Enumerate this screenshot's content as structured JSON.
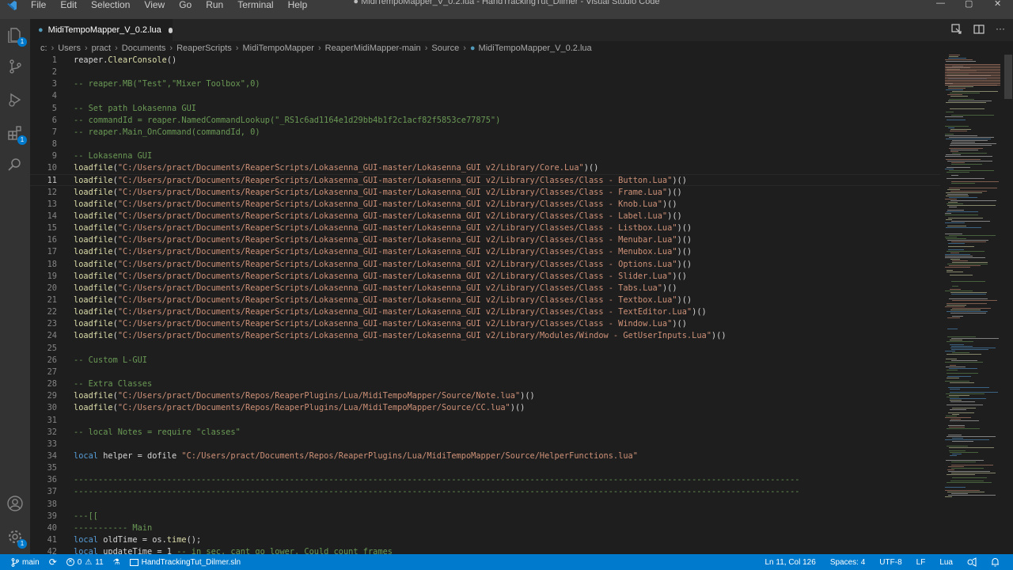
{
  "window": {
    "title": "● MidiTempoMapper_V_0.2.lua - HandTrackingTut_Dilmer - Visual Studio Code",
    "menu": [
      "File",
      "Edit",
      "Selection",
      "View",
      "Go",
      "Run",
      "Terminal",
      "Help"
    ]
  },
  "colors": {
    "accent": "#007acc",
    "comment": "#6a9955",
    "string": "#ce9178",
    "keyword": "#569cd6",
    "function": "#dcdcaa"
  },
  "activity_bar": {
    "items": [
      {
        "icon": "files-icon",
        "badge": "1"
      },
      {
        "icon": "source-control-icon"
      },
      {
        "icon": "run-debug-icon"
      },
      {
        "icon": "extensions-icon",
        "badge": "1"
      },
      {
        "icon": "search-icon"
      }
    ],
    "bottom": [
      {
        "icon": "account-icon"
      },
      {
        "icon": "settings-gear-icon",
        "badge": "1"
      }
    ]
  },
  "tab": {
    "label": "MidiTempoMapper_V_0.2.lua",
    "modified": true
  },
  "breadcrumb": [
    "c:",
    "Users",
    "pract",
    "Documents",
    "ReaperScripts",
    "MidiTempoMapper",
    "ReaperMidiMapper-main",
    "Source",
    "MidiTempoMapper_V_0.2.lua"
  ],
  "editor": {
    "active_line": 11,
    "lines": [
      {
        "n": "1",
        "text": "reaper.ClearConsole()"
      },
      {
        "n": "2",
        "text": ""
      },
      {
        "n": "3",
        "text": "-- reaper.MB(\"Test\",\"Mixer Toolbox\",0)"
      },
      {
        "n": "4",
        "text": ""
      },
      {
        "n": "5",
        "text": "-- Set path Lokasenna GUI"
      },
      {
        "n": "6",
        "text": "-- commandId = reaper.NamedCommandLookup(\"_RS1c6ad1164e1d29bb4b1f2c1acf82f5853ce77875\")"
      },
      {
        "n": "7",
        "text": "-- reaper.Main_OnCommand(commandId, 0)"
      },
      {
        "n": "8",
        "text": ""
      },
      {
        "n": "9",
        "text": "-- Lokasenna GUI"
      },
      {
        "n": "10",
        "text": "loadfile(\"C:/Users/pract/Documents/ReaperScripts/Lokasenna_GUI-master/Lokasenna_GUI v2/Library/Core.Lua\")()"
      },
      {
        "n": "11",
        "text": "loadfile(\"C:/Users/pract/Documents/ReaperScripts/Lokasenna_GUI-master/Lokasenna_GUI v2/Library/Classes/Class - Button.Lua\")()"
      },
      {
        "n": "12",
        "text": "loadfile(\"C:/Users/pract/Documents/ReaperScripts/Lokasenna_GUI-master/Lokasenna_GUI v2/Library/Classes/Class - Frame.Lua\")()"
      },
      {
        "n": "13",
        "text": "loadfile(\"C:/Users/pract/Documents/ReaperScripts/Lokasenna_GUI-master/Lokasenna_GUI v2/Library/Classes/Class - Knob.Lua\")()"
      },
      {
        "n": "14",
        "text": "loadfile(\"C:/Users/pract/Documents/ReaperScripts/Lokasenna_GUI-master/Lokasenna_GUI v2/Library/Classes/Class - Label.Lua\")()"
      },
      {
        "n": "15",
        "text": "loadfile(\"C:/Users/pract/Documents/ReaperScripts/Lokasenna_GUI-master/Lokasenna_GUI v2/Library/Classes/Class - Listbox.Lua\")()"
      },
      {
        "n": "16",
        "text": "loadfile(\"C:/Users/pract/Documents/ReaperScripts/Lokasenna_GUI-master/Lokasenna_GUI v2/Library/Classes/Class - Menubar.Lua\")()"
      },
      {
        "n": "17",
        "text": "loadfile(\"C:/Users/pract/Documents/ReaperScripts/Lokasenna_GUI-master/Lokasenna_GUI v2/Library/Classes/Class - Menubox.Lua\")()"
      },
      {
        "n": "18",
        "text": "loadfile(\"C:/Users/pract/Documents/ReaperScripts/Lokasenna_GUI-master/Lokasenna_GUI v2/Library/Classes/Class - Options.Lua\")()"
      },
      {
        "n": "19",
        "text": "loadfile(\"C:/Users/pract/Documents/ReaperScripts/Lokasenna_GUI-master/Lokasenna_GUI v2/Library/Classes/Class - Slider.Lua\")()"
      },
      {
        "n": "20",
        "text": "loadfile(\"C:/Users/pract/Documents/ReaperScripts/Lokasenna_GUI-master/Lokasenna_GUI v2/Library/Classes/Class - Tabs.Lua\")()"
      },
      {
        "n": "21",
        "text": "loadfile(\"C:/Users/pract/Documents/ReaperScripts/Lokasenna_GUI-master/Lokasenna_GUI v2/Library/Classes/Class - Textbox.Lua\")()"
      },
      {
        "n": "22",
        "text": "loadfile(\"C:/Users/pract/Documents/ReaperScripts/Lokasenna_GUI-master/Lokasenna_GUI v2/Library/Classes/Class - TextEditor.Lua\")()"
      },
      {
        "n": "23",
        "text": "loadfile(\"C:/Users/pract/Documents/ReaperScripts/Lokasenna_GUI-master/Lokasenna_GUI v2/Library/Classes/Class - Window.Lua\")()"
      },
      {
        "n": "24",
        "text": "loadfile(\"C:/Users/pract/Documents/ReaperScripts/Lokasenna_GUI-master/Lokasenna_GUI v2/Library/Modules/Window - GetUserInputs.Lua\")()"
      },
      {
        "n": "25",
        "text": ""
      },
      {
        "n": "26",
        "text": "-- Custom L-GUI"
      },
      {
        "n": "27",
        "text": ""
      },
      {
        "n": "28",
        "text": "-- Extra Classes"
      },
      {
        "n": "29",
        "text": "loadfile(\"C:/Users/pract/Documents/Repos/ReaperPlugins/Lua/MidiTempoMapper/Source/Note.lua\")()"
      },
      {
        "n": "30",
        "text": "loadfile(\"C:/Users/pract/Documents/Repos/ReaperPlugins/Lua/MidiTempoMapper/Source/CC.lua\")()"
      },
      {
        "n": "31",
        "text": ""
      },
      {
        "n": "32",
        "text": "-- local Notes = require \"classes\""
      },
      {
        "n": "33",
        "text": ""
      },
      {
        "n": "34",
        "text": "local helper = dofile \"C:/Users/pract/Documents/Repos/ReaperPlugins/Lua/MidiTempoMapper/Source/HelperFunctions.lua\""
      },
      {
        "n": "35",
        "text": ""
      },
      {
        "n": "36",
        "text": "----------------------------------------------------------------------------------------------------------------------------------------------------"
      },
      {
        "n": "37",
        "text": "----------------------------------------------------------------------------------------------------------------------------------------------------"
      },
      {
        "n": "38",
        "text": ""
      },
      {
        "n": "39",
        "text": "---[["
      },
      {
        "n": "40",
        "text": "----------- Main"
      },
      {
        "n": "41",
        "text": "local oldTime = os.time();"
      },
      {
        "n": "42",
        "text": "local updateTime = 1 -- in sec, cant go lower. Could count frames"
      }
    ]
  },
  "status_bar": {
    "branch": "main",
    "sync": "⟳",
    "errors": "0",
    "warnings": "11",
    "solution": "HandTrackingTut_Dilmer.sln",
    "cursor": "Ln 11, Col 126",
    "spaces": "Spaces: 4",
    "encoding": "UTF-8",
    "eol": "LF",
    "language": "Lua"
  }
}
